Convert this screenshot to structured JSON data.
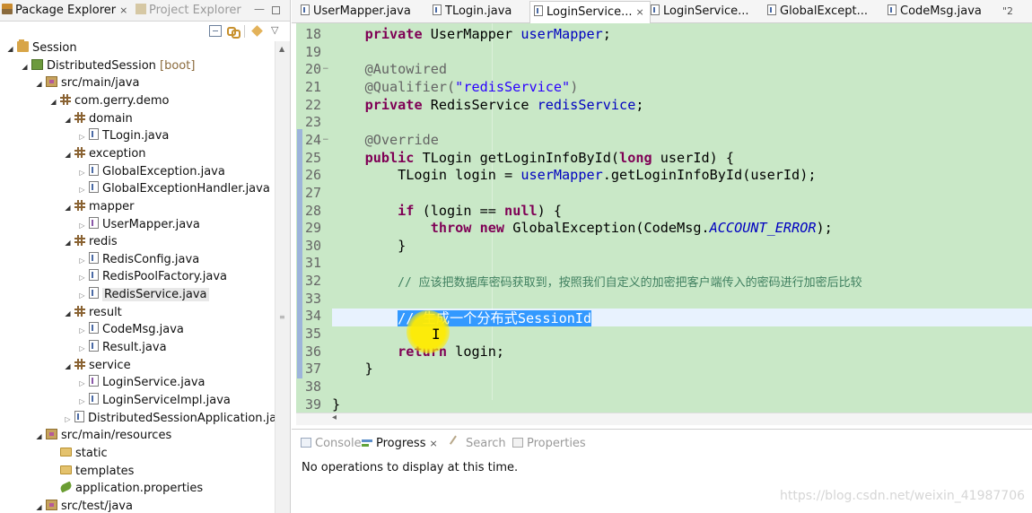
{
  "explorer": {
    "tabs": {
      "package": "Package Explorer",
      "project": "Project Explorer"
    },
    "tree": [
      {
        "label": "Session",
        "icon": "project-icon",
        "indent": 0,
        "state": "open"
      },
      {
        "label": "DistributedSession",
        "suffix": "[boot]",
        "icon": "boot-project-icon",
        "indent": 1,
        "state": "open"
      },
      {
        "label": "src/main/java",
        "icon": "source-folder-icon",
        "indent": 2,
        "state": "open"
      },
      {
        "label": "com.gerry.demo",
        "icon": "package-icon",
        "indent": 3,
        "state": "open"
      },
      {
        "label": "domain",
        "icon": "package-icon",
        "indent": 4,
        "state": "open"
      },
      {
        "label": "TLogin.java",
        "icon": "java-class-icon",
        "indent": 5,
        "state": "closed"
      },
      {
        "label": "exception",
        "icon": "package-icon",
        "indent": 4,
        "state": "open"
      },
      {
        "label": "GlobalException.java",
        "icon": "java-class-icon",
        "indent": 5,
        "state": "closed"
      },
      {
        "label": "GlobalExceptionHandler.java",
        "icon": "java-class-icon",
        "indent": 5,
        "state": "closed"
      },
      {
        "label": "mapper",
        "icon": "package-icon",
        "indent": 4,
        "state": "open"
      },
      {
        "label": "UserMapper.java",
        "icon": "java-interface-icon",
        "indent": 5,
        "state": "closed"
      },
      {
        "label": "redis",
        "icon": "package-icon",
        "indent": 4,
        "state": "open"
      },
      {
        "label": "RedisConfig.java",
        "icon": "java-class-icon",
        "indent": 5,
        "state": "closed"
      },
      {
        "label": "RedisPoolFactory.java",
        "icon": "java-class-icon",
        "indent": 5,
        "state": "closed"
      },
      {
        "label": "RedisService.java",
        "icon": "java-class-icon",
        "indent": 5,
        "state": "closed",
        "selected": true
      },
      {
        "label": "result",
        "icon": "package-icon",
        "indent": 4,
        "state": "open"
      },
      {
        "label": "CodeMsg.java",
        "icon": "java-class-icon",
        "indent": 5,
        "state": "closed"
      },
      {
        "label": "Result.java",
        "icon": "java-class-icon",
        "indent": 5,
        "state": "closed"
      },
      {
        "label": "service",
        "icon": "package-icon",
        "indent": 4,
        "state": "open"
      },
      {
        "label": "LoginService.java",
        "icon": "java-interface-icon",
        "indent": 5,
        "state": "closed"
      },
      {
        "label": "LoginServiceImpl.java",
        "icon": "java-class-icon",
        "indent": 5,
        "state": "closed"
      },
      {
        "label": "DistributedSessionApplication.jav",
        "icon": "java-class-icon",
        "indent": 4,
        "state": "closed"
      },
      {
        "label": "src/main/resources",
        "icon": "source-folder-icon",
        "indent": 2,
        "state": "open"
      },
      {
        "label": "static",
        "icon": "folder-icon",
        "indent": 3,
        "state": "none"
      },
      {
        "label": "templates",
        "icon": "folder-icon",
        "indent": 3,
        "state": "none"
      },
      {
        "label": "application.properties",
        "icon": "properties-icon",
        "indent": 3,
        "state": "none"
      },
      {
        "label": "src/test/java",
        "icon": "source-folder-icon",
        "indent": 2,
        "state": "open"
      }
    ]
  },
  "editor": {
    "tabs": [
      {
        "label": "UserMapper.java",
        "active": false
      },
      {
        "label": "TLogin.java",
        "active": false
      },
      {
        "label": "LoginService...",
        "active": true
      },
      {
        "label": "LoginService...",
        "active": false
      },
      {
        "label": "GlobalExcept...",
        "active": false
      },
      {
        "label": "CodeMsg.java",
        "active": false
      }
    ],
    "overflow": "\"2",
    "lines": [
      {
        "n": "18",
        "tokens": [
          [
            "    ",
            ""
          ],
          [
            "private",
            "kw"
          ],
          [
            " UserMapper ",
            ""
          ],
          [
            "userMapper",
            "fld"
          ],
          [
            ";",
            ""
          ]
        ]
      },
      {
        "n": "19",
        "tokens": []
      },
      {
        "n": "20",
        "fold": true,
        "tokens": [
          [
            "    ",
            ""
          ],
          [
            "@Autowired",
            "ann"
          ]
        ]
      },
      {
        "n": "21",
        "tokens": [
          [
            "    ",
            ""
          ],
          [
            "@Qualifier(",
            "ann"
          ],
          [
            "\"redisService\"",
            "str"
          ],
          [
            ")",
            "ann"
          ]
        ]
      },
      {
        "n": "22",
        "tokens": [
          [
            "    ",
            ""
          ],
          [
            "private",
            "kw"
          ],
          [
            " RedisService ",
            ""
          ],
          [
            "redisService",
            "fld"
          ],
          [
            ";",
            ""
          ]
        ]
      },
      {
        "n": "23",
        "tokens": []
      },
      {
        "n": "24",
        "fold": true,
        "tokens": [
          [
            "    ",
            ""
          ],
          [
            "@Override",
            "ann"
          ]
        ]
      },
      {
        "n": "25",
        "tokens": [
          [
            "    ",
            ""
          ],
          [
            "public",
            "kw"
          ],
          [
            " TLogin getLoginInfoById(",
            ""
          ],
          [
            "long",
            "kw"
          ],
          [
            " userId) {",
            ""
          ]
        ]
      },
      {
        "n": "26",
        "tokens": [
          [
            "        TLogin login = ",
            ""
          ],
          [
            "userMapper",
            "fld"
          ],
          [
            ".getLoginInfoById(userId);",
            ""
          ]
        ]
      },
      {
        "n": "27",
        "tokens": []
      },
      {
        "n": "28",
        "tokens": [
          [
            "        ",
            ""
          ],
          [
            "if",
            "kw"
          ],
          [
            " (login == ",
            ""
          ],
          [
            "null",
            "kw"
          ],
          [
            ") {",
            ""
          ]
        ]
      },
      {
        "n": "29",
        "tokens": [
          [
            "            ",
            ""
          ],
          [
            "throw",
            "kw"
          ],
          [
            " ",
            ""
          ],
          [
            "new",
            "kw"
          ],
          [
            " GlobalException(CodeMsg.",
            ""
          ],
          [
            "ACCOUNT_ERROR",
            "cst"
          ],
          [
            ");",
            ""
          ]
        ]
      },
      {
        "n": "30",
        "tokens": [
          [
            "        }",
            ""
          ]
        ]
      },
      {
        "n": "31",
        "tokens": []
      },
      {
        "n": "32",
        "tokens": [
          [
            "        ",
            ""
          ],
          [
            "// 应该把数据库密码获取到，按照我们自定义的加密把客户端传入的密码进行加密后比较",
            "cmt"
          ]
        ]
      },
      {
        "n": "33",
        "tokens": []
      },
      {
        "n": "34",
        "tokens": [
          [
            "        ",
            ""
          ],
          [
            "// 生成一个分布式SessionId",
            "sel"
          ]
        ]
      },
      {
        "n": "35",
        "tokens": []
      },
      {
        "n": "36",
        "tokens": [
          [
            "        ",
            ""
          ],
          [
            "return",
            "kw"
          ],
          [
            " login;",
            ""
          ]
        ]
      },
      {
        "n": "37",
        "tokens": [
          [
            "    }",
            ""
          ]
        ]
      },
      {
        "n": "38",
        "tokens": []
      },
      {
        "n": "39",
        "tokens": [
          [
            "}",
            ""
          ]
        ]
      }
    ]
  },
  "bottom": {
    "tabs": [
      {
        "label": "Console",
        "icon": "console-icon",
        "active": false
      },
      {
        "label": "Progress",
        "icon": "progress-icon",
        "active": true
      },
      {
        "label": "Search",
        "icon": "search-icon",
        "active": false
      },
      {
        "label": "Properties",
        "icon": "properties-view-icon",
        "active": false
      }
    ],
    "message": "No operations to display at this time."
  },
  "watermark": "https://blog.csdn.net/weixin_41987706"
}
